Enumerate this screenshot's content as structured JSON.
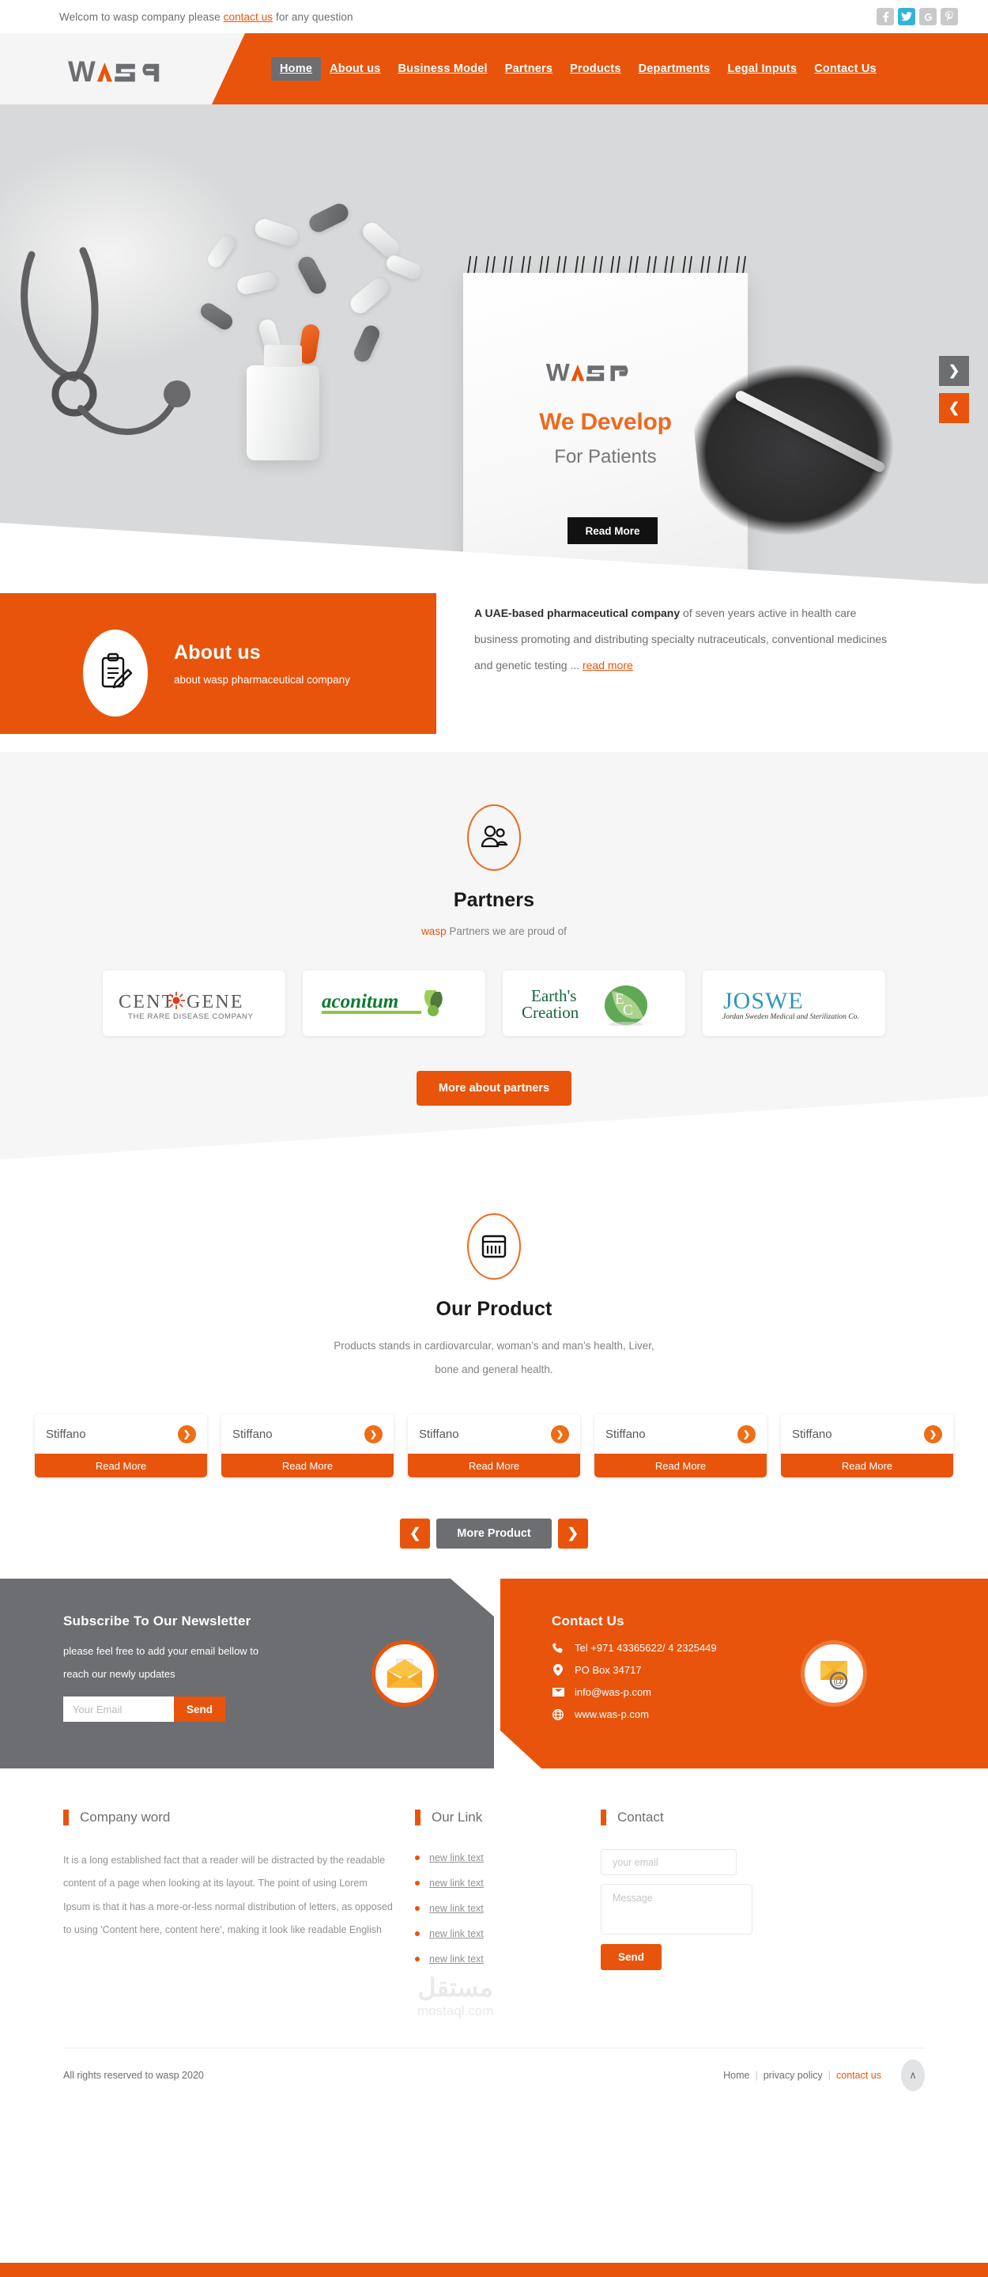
{
  "topbar": {
    "welcome_prefix": "Welcom to wasp company please ",
    "welcome_link": "contact us",
    "welcome_suffix": " for any question",
    "socials": [
      {
        "name": "facebook-icon",
        "glyph": "f"
      },
      {
        "name": "twitter-icon",
        "glyph": "t"
      },
      {
        "name": "google-plus-icon",
        "glyph": "G"
      },
      {
        "name": "pinterest-icon",
        "glyph": "P"
      }
    ]
  },
  "brand": {
    "name": "WASP",
    "accent_color": "#e8540c",
    "gray_color": "#6d6e71"
  },
  "nav": {
    "items": [
      {
        "label": "Home",
        "active": true
      },
      {
        "label": "About us",
        "active": false
      },
      {
        "label": "Business Model",
        "active": false
      },
      {
        "label": "Partners",
        "active": false
      },
      {
        "label": "Products",
        "active": false
      },
      {
        "label": "Departments",
        "active": false
      },
      {
        "label": "Legal Inputs",
        "active": false
      },
      {
        "label": "Contact Us",
        "active": false
      }
    ]
  },
  "hero": {
    "logo_text": "WASP",
    "headline": "We Develop",
    "subheadline": "For Patients",
    "button": "Read More",
    "next_arrow": "❯",
    "prev_arrow": "❮"
  },
  "about": {
    "title": "About us",
    "subtitle": "about wasp pharmaceutical company",
    "body_bold": "A UAE-based pharmaceutical company",
    "body_rest": " of seven years active in health care business promoting and distributing specialty nutraceuticals, conventional medicines and genetic testing ... ",
    "read_more": "read more"
  },
  "partners": {
    "title": "Partners",
    "sub_brand": "wasp",
    "sub_rest": " Partners we are proud of",
    "logos": [
      {
        "name": "CENTOGENE",
        "tagline": "THE RARE DISEASE COMPANY"
      },
      {
        "name": "aconitum",
        "tagline": ""
      },
      {
        "name": "Earth's Creation",
        "tagline": ""
      },
      {
        "name": "JOSWE",
        "tagline": "Jordan Sweden Medical and Sterilization Co."
      }
    ],
    "cta": "More about partners"
  },
  "products": {
    "title": "Our Product",
    "subtitle_line1": "Products stands in cardiovarcular, woman’s and man’s health, Liver,",
    "subtitle_line2": "bone and general health.",
    "items": [
      {
        "name": "Stiffano",
        "read_more": "Read More"
      },
      {
        "name": "Stiffano",
        "read_more": "Read More"
      },
      {
        "name": "Stiffano",
        "read_more": "Read More"
      },
      {
        "name": "Stiffano",
        "read_more": "Read More"
      },
      {
        "name": "Stiffano",
        "read_more": "Read More"
      }
    ],
    "prev": "❮",
    "next": "❯",
    "more": "More Product"
  },
  "newsletter": {
    "title": "Subscribe To Our Newsletter",
    "desc": "please feel free to add your email bellow to reach our newly updates",
    "placeholder": "Your Email",
    "value": "",
    "button": "Send"
  },
  "contact_cta": {
    "title": "Contact Us",
    "lines": [
      {
        "icon": "phone-icon",
        "text": "Tel +971 43365622/ 4 2325449"
      },
      {
        "icon": "location-pin-icon",
        "text": "PO Box 34717"
      },
      {
        "icon": "envelope-icon",
        "text": "info@was-p.com"
      },
      {
        "icon": "globe-icon",
        "text": "www.was-p.com"
      }
    ]
  },
  "footer": {
    "company_word": {
      "heading": "Company word",
      "text": "It is a long established fact that a reader will be distracted by the readable content of a page when looking at its layout. The point of using Lorem Ipsum is that it has a more-or-less normal distribution of letters, as opposed to using 'Content here, content here', making it look like readable English"
    },
    "our_link": {
      "heading": "Our Link",
      "links": [
        "new link text",
        "new link text",
        "new link text",
        "new link text",
        "new link text"
      ]
    },
    "contact": {
      "heading": "Contact",
      "email_placeholder": "your email",
      "email_value": "",
      "message_placeholder": "Message",
      "message_value": "",
      "send": "Send"
    },
    "watermark_ar": "مستقل",
    "watermark_en": "mostaql.com"
  },
  "bottom": {
    "copyright": "All rights reserved to wasp 2020",
    "links": [
      {
        "label": "Home",
        "accent": false
      },
      {
        "label": "privacy policy",
        "accent": false
      },
      {
        "label": "contact us",
        "accent": true
      }
    ],
    "to_top_icon": "∧"
  }
}
